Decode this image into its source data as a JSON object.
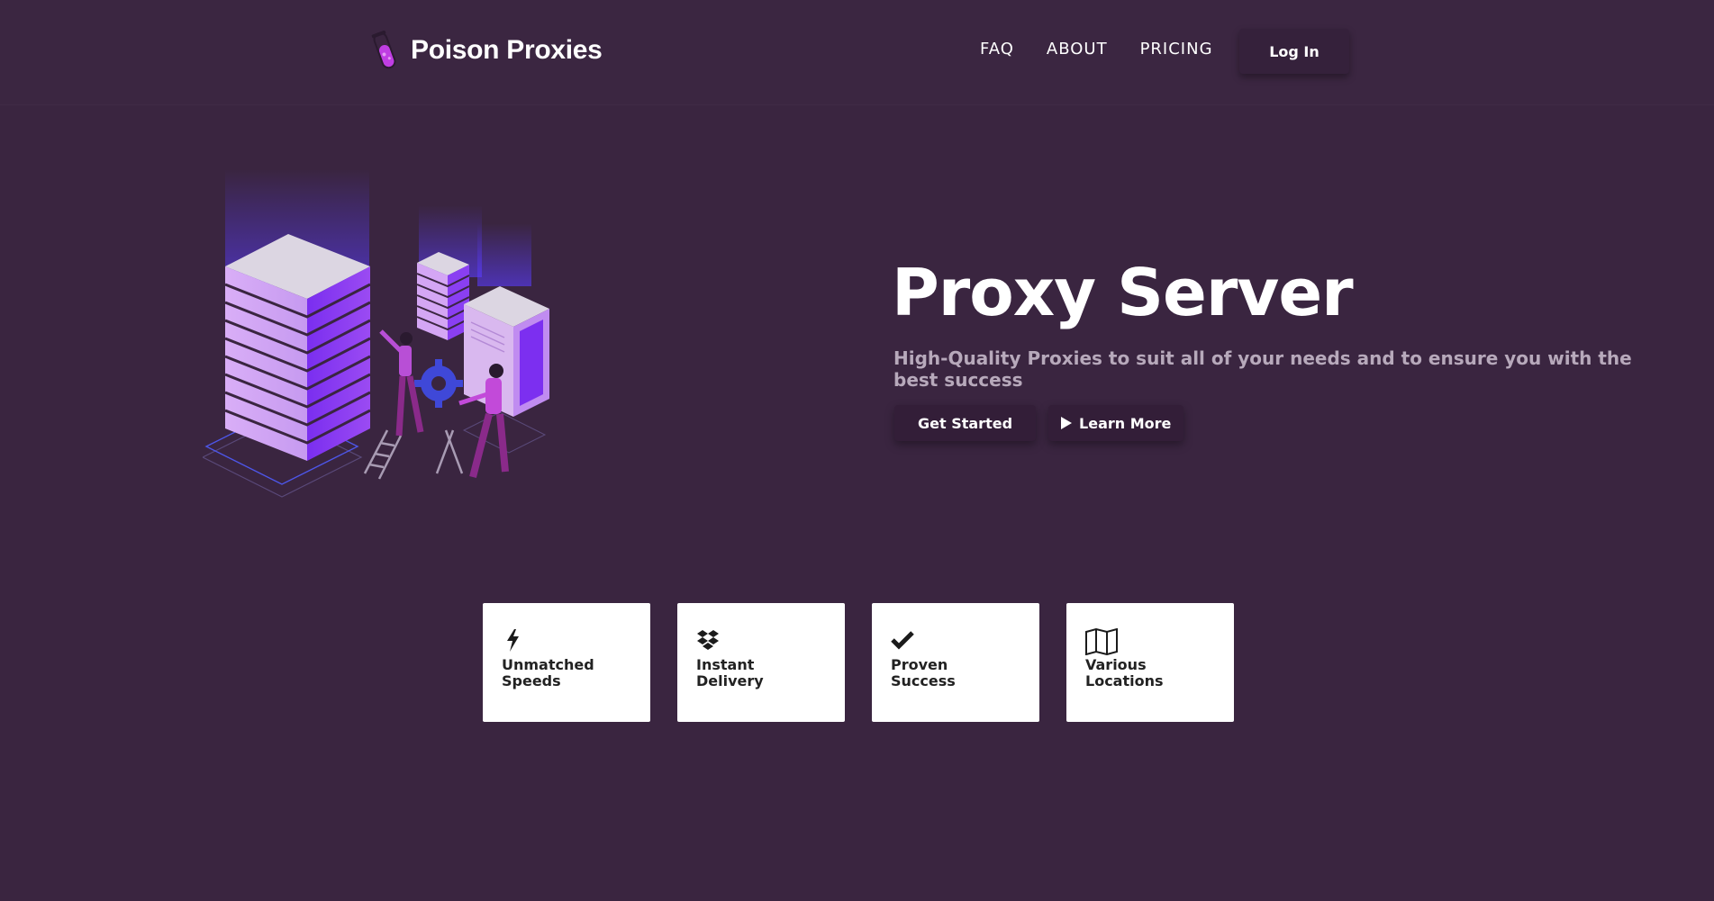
{
  "brand": {
    "name": "Poison Proxies",
    "logo_icon": "test-tube-icon",
    "accent": "#b53ddb"
  },
  "nav": {
    "links": [
      {
        "label": "FAQ"
      },
      {
        "label": "ABOUT"
      },
      {
        "label": "PRICING"
      }
    ],
    "login_label": "Log In"
  },
  "hero": {
    "title": "Proxy Server",
    "subtitle": "High-Quality Proxies to suit all of your needs and to ensure you with the best success",
    "get_started_label": "Get Started",
    "learn_more_label": "Learn More",
    "illustration": "server-racks-illustration"
  },
  "features": [
    {
      "label": "Unmatched\nSpeeds",
      "icon": "bolt-icon"
    },
    {
      "label": "Instant\nDelivery",
      "icon": "dropbox-icon"
    },
    {
      "label": "Proven\nSuccess",
      "icon": "check-icon"
    },
    {
      "label": "Various\nLocations",
      "icon": "map-icon"
    }
  ],
  "colors": {
    "background": "#3a2540",
    "button_bg": "#331e38",
    "subtitle": "#b7a9bb",
    "card_bg": "#ffffff"
  }
}
